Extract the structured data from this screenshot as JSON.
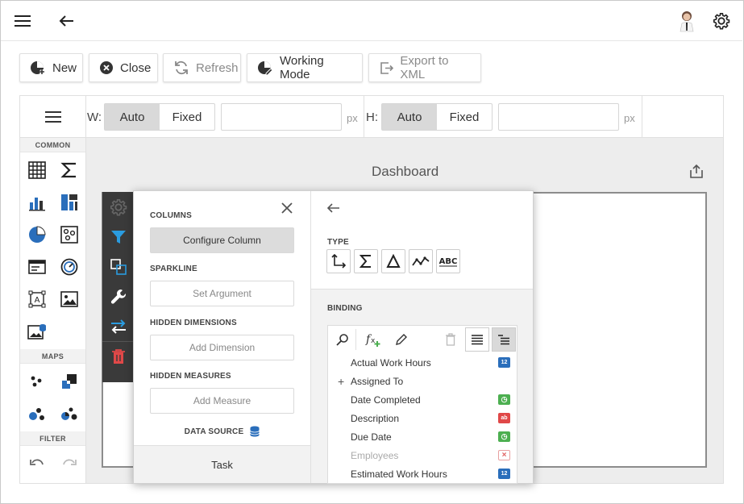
{
  "header": {
    "menu_icon": "hamburger-icon",
    "back_icon": "arrow-left-icon",
    "settings_icon": "gear-icon"
  },
  "toolbar": {
    "new_label": "New",
    "close_label": "Close",
    "refresh_label": "Refresh",
    "working_mode_label": "Working Mode",
    "export_label": "Export to XML"
  },
  "size_bar": {
    "width_label": "W:",
    "height_label": "H:",
    "auto_label": "Auto",
    "fixed_label": "Fixed",
    "unit": "px",
    "width_value": "",
    "height_value": ""
  },
  "toolbox": {
    "sections": [
      "COMMON",
      "MAPS",
      "FILTER"
    ]
  },
  "dashboard": {
    "title": "Dashboard"
  },
  "properties": {
    "columns_header": "COLUMNS",
    "configure_column": "Configure Column",
    "sparkline_header": "SPARKLINE",
    "set_argument": "Set Argument",
    "hidden_dimensions_header": "HIDDEN DIMENSIONS",
    "add_dimension": "Add Dimension",
    "hidden_measures_header": "HIDDEN MEASURES",
    "add_measure": "Add Measure",
    "data_source_header": "DATA SOURCE",
    "data_source_name": "Task"
  },
  "binding": {
    "type_header": "TYPE",
    "binding_header": "BINDING",
    "fields": [
      {
        "name": "Actual Work Hours",
        "badge": "12",
        "color": "#2a6ebb",
        "expandable": false,
        "disabled": false
      },
      {
        "name": "Assigned To",
        "badge": "",
        "color": "",
        "expandable": true,
        "disabled": false
      },
      {
        "name": "Date Completed",
        "badge": "◷",
        "color": "#4caf50",
        "expandable": false,
        "disabled": false
      },
      {
        "name": "Description",
        "badge": "ab",
        "color": "#e04848",
        "expandable": false,
        "disabled": false
      },
      {
        "name": "Due Date",
        "badge": "◷",
        "color": "#4caf50",
        "expandable": false,
        "disabled": false
      },
      {
        "name": "Employees",
        "badge": "×",
        "color": "#e88080",
        "expandable": false,
        "disabled": true
      },
      {
        "name": "Estimated Work Hours",
        "badge": "12",
        "color": "#2a6ebb",
        "expandable": false,
        "disabled": false
      }
    ]
  },
  "colors": {
    "accent_blue": "#2a6ebb",
    "delete_red": "#e04848",
    "item_menu_bg": "#3a3a3a"
  }
}
